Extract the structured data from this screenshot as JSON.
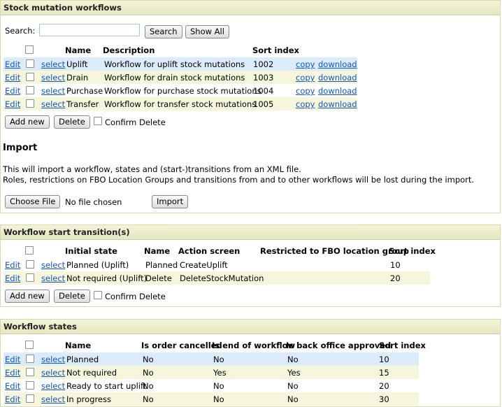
{
  "stock": {
    "header": "Stock mutation workflows",
    "search_label": "Search:",
    "search_value": "",
    "search_button": "Search",
    "show_all_button": "Show All",
    "columns": {
      "name": "Name",
      "description": "Description",
      "sort_index": "Sort index"
    },
    "rows": [
      {
        "edit": "Edit",
        "select": "select",
        "name": "Uplift",
        "description": "Workflow for uplift stock mutations",
        "sort_index": "1002",
        "copy": "copy",
        "download": "download"
      },
      {
        "edit": "Edit",
        "select": "select",
        "name": "Drain",
        "description": "Workflow for drain stock mutations",
        "sort_index": "1003",
        "copy": "copy",
        "download": "download"
      },
      {
        "edit": "Edit",
        "select": "select",
        "name": "Purchase",
        "description": "Workflow for purchase stock mutations",
        "sort_index": "1004",
        "copy": "copy",
        "download": "download"
      },
      {
        "edit": "Edit",
        "select": "select",
        "name": "Transfer",
        "description": "Workflow for transfer stock mutations",
        "sort_index": "1005",
        "copy": "copy",
        "download": "download"
      }
    ],
    "add_new": "Add new",
    "delete": "Delete",
    "confirm_delete": "Confirm Delete"
  },
  "import": {
    "title": "Import",
    "line1": "This will import a workflow, states and (start-)transitions from an XML file.",
    "line2": "Roles, restrictions on FBO Location Groups and transitions from and to other workflows will be lost during the import.",
    "choose_file": "Choose File",
    "no_file": "No file chosen",
    "import_button": "Import"
  },
  "transitions": {
    "header": "Workflow start transition(s)",
    "columns": {
      "initial_state": "Initial state",
      "name": "Name",
      "action_screen": "Action screen",
      "restricted": "Restricted to FBO location group",
      "sort_index": "Sort index"
    },
    "rows": [
      {
        "edit": "Edit",
        "select": "select",
        "initial_state": "Planned (Uplift)",
        "name": "Planned",
        "action_screen": "CreateUplift",
        "restricted": "",
        "sort_index": "10"
      },
      {
        "edit": "Edit",
        "select": "select",
        "initial_state": "Not required (Uplift)",
        "name": "Delete",
        "action_screen": "DeleteStockMutation",
        "restricted": "",
        "sort_index": "20"
      }
    ],
    "add_new": "Add new",
    "delete": "Delete",
    "confirm_delete": "Confirm Delete"
  },
  "states": {
    "header": "Workflow states",
    "columns": {
      "name": "Name",
      "cancelled": "Is order cancelled",
      "end": "Is end of workflow",
      "back_office": "Is back office approved",
      "sort_index": "Sort index"
    },
    "rows": [
      {
        "edit": "Edit",
        "select": "select",
        "name": "Planned",
        "cancelled": "No",
        "end": "No",
        "back_office": "No",
        "sort_index": "10"
      },
      {
        "edit": "Edit",
        "select": "select",
        "name": "Not required",
        "cancelled": "No",
        "end": "Yes",
        "back_office": "Yes",
        "sort_index": "15"
      },
      {
        "edit": "Edit",
        "select": "select",
        "name": "Ready to start uplift",
        "cancelled": "No",
        "end": "No",
        "back_office": "No",
        "sort_index": "20"
      },
      {
        "edit": "Edit",
        "select": "select",
        "name": "In progress",
        "cancelled": "No",
        "end": "No",
        "back_office": "No",
        "sort_index": "30"
      }
    ]
  },
  "colors": {
    "link": "#1155cc",
    "row_selected": "#dcebfa",
    "row_alt": "#f6f6dd",
    "header_bg": "#e6e6c2"
  }
}
